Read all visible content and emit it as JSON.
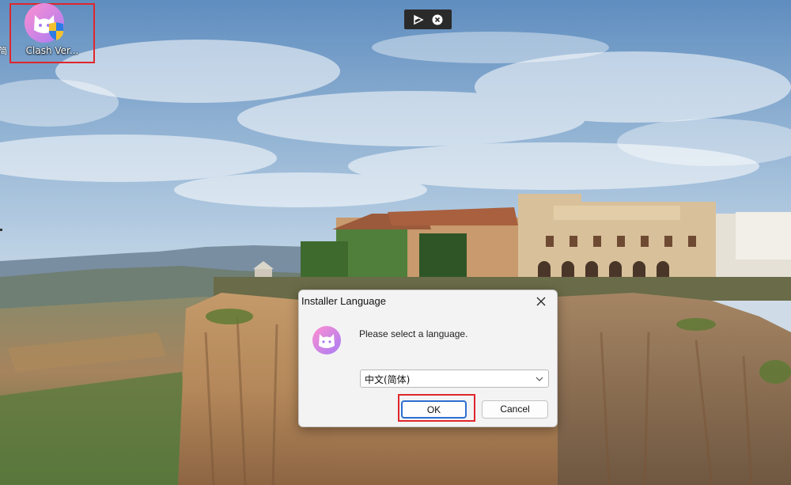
{
  "desktop": {
    "icon_label": "Clash Ver...",
    "edge_char": "简"
  },
  "recording_toolbar": {
    "icons": [
      "flag-icon",
      "stop-icon"
    ]
  },
  "dialog": {
    "title": "Installer Language",
    "message": "Please select a language.",
    "language_select": {
      "value": "中文(简体)"
    },
    "ok_label": "OK",
    "cancel_label": "Cancel"
  },
  "colors": {
    "highlight": "#e0262b",
    "focus_border": "#2c6fd1",
    "app_icon_gradient": [
      "#ff8fd0",
      "#a77cf5"
    ]
  }
}
